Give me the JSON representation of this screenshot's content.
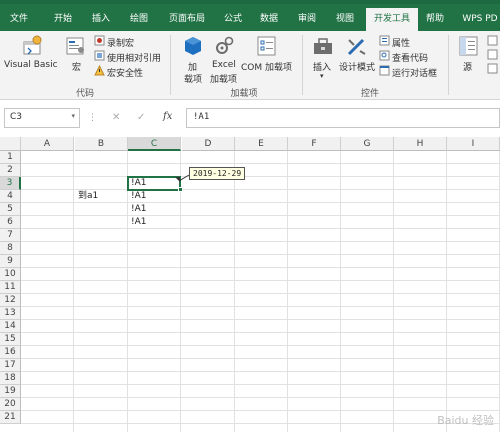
{
  "menu": {
    "tabs": [
      "文件",
      "开始",
      "插入",
      "绘图",
      "页面布局",
      "公式",
      "数据",
      "审阅",
      "视图",
      "开发工具",
      "帮助",
      "WPS PD"
    ],
    "active_tab": "开发工具"
  },
  "ribbon": {
    "code": {
      "visual_basic": "Visual Basic",
      "macros": "宏",
      "record_macro": "录制宏",
      "relative_ref": "使用相对引用",
      "macro_security": "宏安全性",
      "label": "代码"
    },
    "addins": {
      "addins_line1": "加",
      "addins_line2": "载项",
      "excel_line1": "Excel",
      "excel_line2": "加载项",
      "com": "COM 加载项",
      "label": "加载项"
    },
    "controls": {
      "insert": "插入",
      "design_mode": "设计模式",
      "properties": "属性",
      "view_code": "查看代码",
      "run_dialog": "运行对话框",
      "label": "控件"
    },
    "xml": {
      "source": "源"
    }
  },
  "formula_bar": {
    "name_box": "C3",
    "cancel": "✕",
    "enter": "✓",
    "fx": "fx",
    "content": "!A1"
  },
  "sheet": {
    "columns": [
      "A",
      "B",
      "C",
      "D",
      "E",
      "F",
      "G",
      "H",
      "I"
    ],
    "rows": [
      "1",
      "2",
      "3",
      "4",
      "5",
      "6",
      "7",
      "8",
      "9",
      "10",
      "11",
      "12",
      "13",
      "14",
      "15",
      "16",
      "17",
      "18",
      "19",
      "20",
      "21"
    ],
    "selected_cell": "C3",
    "cells": {
      "B4": "到a1",
      "C3": "!A1",
      "C4": "!A1",
      "C5": "!A1",
      "C6": "!A1"
    },
    "tooltip": "2019-12-29"
  },
  "watermark": "Baidu 经验"
}
